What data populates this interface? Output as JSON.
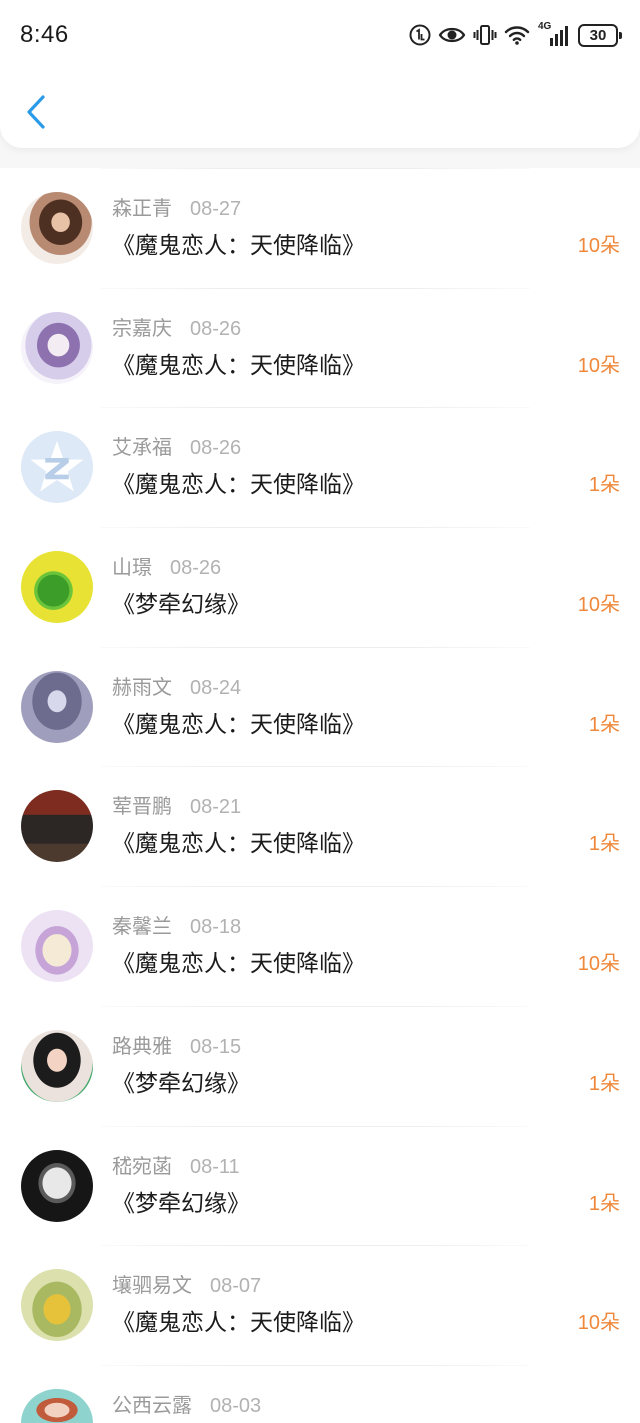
{
  "status_bar": {
    "time": "8:46",
    "network_label": "4G",
    "battery_level": "30",
    "icons": [
      "hd-call-icon",
      "eye-icon",
      "vibrate-icon",
      "wifi-icon",
      "signal-icon",
      "battery-icon"
    ]
  },
  "header": {
    "back_icon": "chevron-left-icon"
  },
  "colors": {
    "accent": "#2a9be8",
    "count": "#ef883b",
    "name": "#9a9a9a",
    "date": "#b2b2b2",
    "title": "#1c1c1c"
  },
  "list": {
    "items": [
      {
        "name": "森正青",
        "date": "08-27",
        "title": "《魔鬼恋人：天使降临》",
        "count": "10朵"
      },
      {
        "name": "宗嘉庆",
        "date": "08-26",
        "title": "《魔鬼恋人：天使降临》",
        "count": "10朵"
      },
      {
        "name": "艾承福",
        "date": "08-26",
        "title": "《魔鬼恋人：天使降临》",
        "count": "1朵"
      },
      {
        "name": "山璟",
        "date": "08-26",
        "title": "《梦牵幻缘》",
        "count": "10朵"
      },
      {
        "name": "赫雨文",
        "date": "08-24",
        "title": "《魔鬼恋人：天使降临》",
        "count": "1朵"
      },
      {
        "name": "荤晋鹏",
        "date": "08-21",
        "title": "《魔鬼恋人：天使降临》",
        "count": "1朵"
      },
      {
        "name": "秦馨兰",
        "date": "08-18",
        "title": "《魔鬼恋人：天使降临》",
        "count": "10朵"
      },
      {
        "name": "路典雅",
        "date": "08-15",
        "title": "《梦牵幻缘》",
        "count": "1朵"
      },
      {
        "name": "嵇宛菡",
        "date": "08-11",
        "title": "《梦牵幻缘》",
        "count": "1朵"
      },
      {
        "name": "壤驷易文",
        "date": "08-07",
        "title": "《魔鬼恋人：天使降临》",
        "count": "10朵"
      },
      {
        "name": "公西云露",
        "date": "08-03"
      }
    ]
  }
}
